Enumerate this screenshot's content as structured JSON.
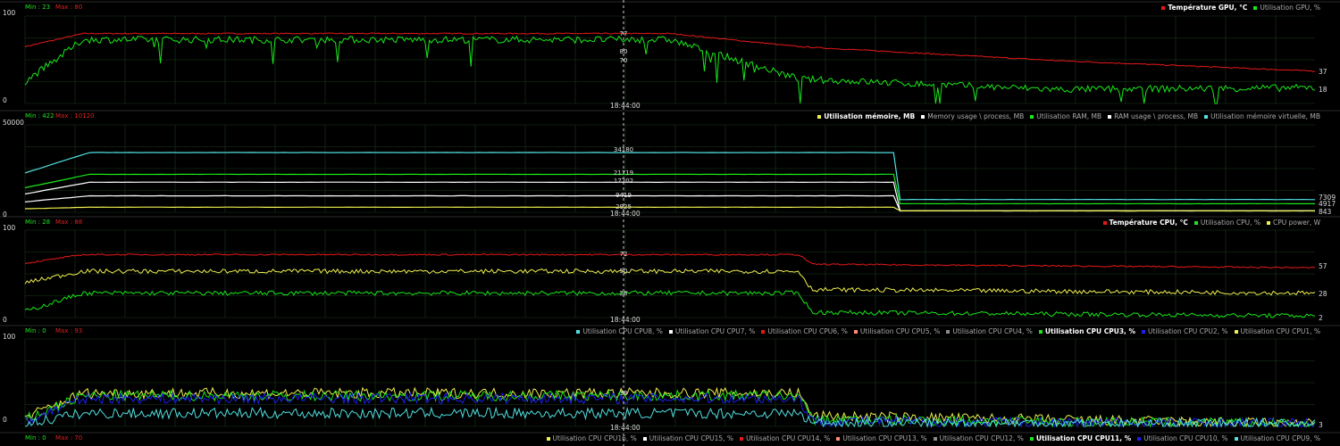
{
  "colors": {
    "red": "#e81818",
    "green": "#19e819",
    "yellow": "#f0f050",
    "white": "#ffffff",
    "cyan": "#50e0e0",
    "blue": "#1e1ef0",
    "salmon": "#ff8c78",
    "grey": "#8c8c8c",
    "grid": "#1c3a1c"
  },
  "cursor_time": "18:44:00",
  "panels": [
    {
      "id": "gpu",
      "min_label": "Min : 23",
      "max_label": "Max : 80",
      "y_axis": [
        "100",
        "0"
      ],
      "cursor_values": [
        "77",
        "80",
        "70"
      ],
      "right_values": [
        "37",
        "18"
      ],
      "legend": [
        {
          "label": "Température GPU, °C",
          "color": "#e81818",
          "selected": true
        },
        {
          "label": "Utilisation GPU, %",
          "color": "#19e819",
          "selected": false
        }
      ]
    },
    {
      "id": "memory",
      "min_label": "Min : 422",
      "max_label": "Max : 10120",
      "y_axis": [
        "50000",
        "0"
      ],
      "cursor_values": [
        "34180",
        "21719",
        "17202",
        "9419",
        "2925"
      ],
      "right_values": [
        "7309",
        "4917",
        "843"
      ],
      "legend": [
        {
          "label": "Utilisation mémoire, MB",
          "color": "#f0f050",
          "selected": true
        },
        {
          "label": "Memory usage \\ process, MB",
          "color": "#ffffff",
          "selected": false
        },
        {
          "label": "Utilisation RAM, MB",
          "color": "#19e819",
          "selected": false
        },
        {
          "label": "RAM usage \\ process, MB",
          "color": "#ffffff",
          "selected": false
        },
        {
          "label": "Utilisation mémoire virtuelle, MB",
          "color": "#50e0e0",
          "selected": false
        }
      ]
    },
    {
      "id": "cpu",
      "min_label": "Min : 28",
      "max_label": "Max : 88",
      "y_axis": [
        "100",
        "0"
      ],
      "cursor_values": [
        "72",
        "50",
        "28"
      ],
      "right_values": [
        "57",
        "28",
        "2"
      ],
      "legend": [
        {
          "label": "Température CPU, °C",
          "color": "#e81818",
          "selected": true
        },
        {
          "label": "Utilisation CPU, %",
          "color": "#19e819",
          "selected": false
        },
        {
          "label": "CPU power, W",
          "color": "#f0f050",
          "selected": false
        }
      ]
    },
    {
      "id": "cores1",
      "min_label": "Min : 0",
      "max_label": "Max : 93",
      "y_axis": [
        "100",
        "0"
      ],
      "cursor_values": [
        "38"
      ],
      "right_values": [
        "3"
      ],
      "legend": [
        {
          "label": "Utilisation CPU CPU8, %",
          "color": "#50e0e0",
          "selected": false
        },
        {
          "label": "Utilisation CPU CPU7, %",
          "color": "#ffffff",
          "selected": false
        },
        {
          "label": "Utilisation CPU CPU6, %",
          "color": "#e81818",
          "selected": false
        },
        {
          "label": "Utilisation CPU CPU5, %",
          "color": "#ff8c78",
          "selected": false
        },
        {
          "label": "Utilisation CPU CPU4, %",
          "color": "#8c8c8c",
          "selected": false
        },
        {
          "label": "Utilisation CPU CPU3, %",
          "color": "#19e819",
          "selected": true
        },
        {
          "label": "Utilisation CPU CPU2, %",
          "color": "#1e1ef0",
          "selected": false
        },
        {
          "label": "Utilisation CPU CPU1, %",
          "color": "#f0f050",
          "selected": false
        }
      ]
    },
    {
      "id": "cores2",
      "min_label": "Min : 0",
      "max_label": "Max : 70",
      "y_axis": [],
      "cursor_values": [],
      "right_values": [],
      "legend": [
        {
          "label": "Utilisation CPU CPU16, %",
          "color": "#f0f050",
          "selected": false
        },
        {
          "label": "Utilisation CPU CPU15, %",
          "color": "#ffffff",
          "selected": false
        },
        {
          "label": "Utilisation CPU CPU14, %",
          "color": "#e81818",
          "selected": false
        },
        {
          "label": "Utilisation CPU CPU13, %",
          "color": "#ff8c78",
          "selected": false
        },
        {
          "label": "Utilisation CPU CPU12, %",
          "color": "#8c8c8c",
          "selected": false
        },
        {
          "label": "Utilisation CPU CPU11, %",
          "color": "#19e819",
          "selected": true
        },
        {
          "label": "Utilisation CPU CPU10, %",
          "color": "#1e1ef0",
          "selected": false
        },
        {
          "label": "Utilisation CPU CPU9, %",
          "color": "#50e0e0",
          "selected": false
        }
      ]
    }
  ],
  "chart_data": [
    {
      "type": "line",
      "series": [
        {
          "name": "Température GPU, °C",
          "values": [
            65,
            80,
            80,
            65,
            49,
            37
          ]
        },
        {
          "name": "Utilisation GPU, %",
          "values": [
            25,
            73,
            73,
            28,
            16,
            18
          ]
        }
      ]
    },
    {
      "type": "line",
      "series": [
        {
          "name": "Utilisation mémoire virtuelle, MB",
          "values": [
            22500,
            34180,
            34180,
            7309
          ]
        },
        {
          "name": "Utilisation RAM, MB",
          "values": [
            14000,
            21719,
            21719,
            4917
          ]
        },
        {
          "name": "Memory usage \\ process, MB",
          "values": [
            10500,
            17202,
            17202,
            843
          ]
        },
        {
          "name": "RAM usage \\ process, MB",
          "values": [
            6000,
            9419,
            9419,
            843
          ]
        },
        {
          "name": "Utilisation mémoire, MB",
          "values": [
            2000,
            2925,
            2925,
            843
          ]
        }
      ]
    },
    {
      "type": "line",
      "series": [
        {
          "name": "Température CPU, °C",
          "values": [
            62,
            72,
            72,
            57
          ]
        },
        {
          "name": "CPU power, W",
          "values": [
            40,
            53,
            53,
            28
          ]
        },
        {
          "name": "Utilisation CPU, %",
          "values": [
            7,
            28,
            28,
            2
          ]
        }
      ]
    },
    {
      "type": "line",
      "series": [
        {
          "name": "Utilisation CPU CPU1, %",
          "values": [
            10,
            38,
            38,
            12,
            3
          ]
        },
        {
          "name": "Utilisation CPU CPU3, %",
          "values": [
            8,
            35,
            35,
            8,
            3
          ]
        },
        {
          "name": "Utilisation CPU CPU2, %",
          "values": [
            5,
            32,
            32,
            6,
            3
          ]
        },
        {
          "name": "Utilisation CPU CPU8, %",
          "values": [
            3,
            15,
            15,
            4,
            3
          ]
        }
      ]
    }
  ]
}
